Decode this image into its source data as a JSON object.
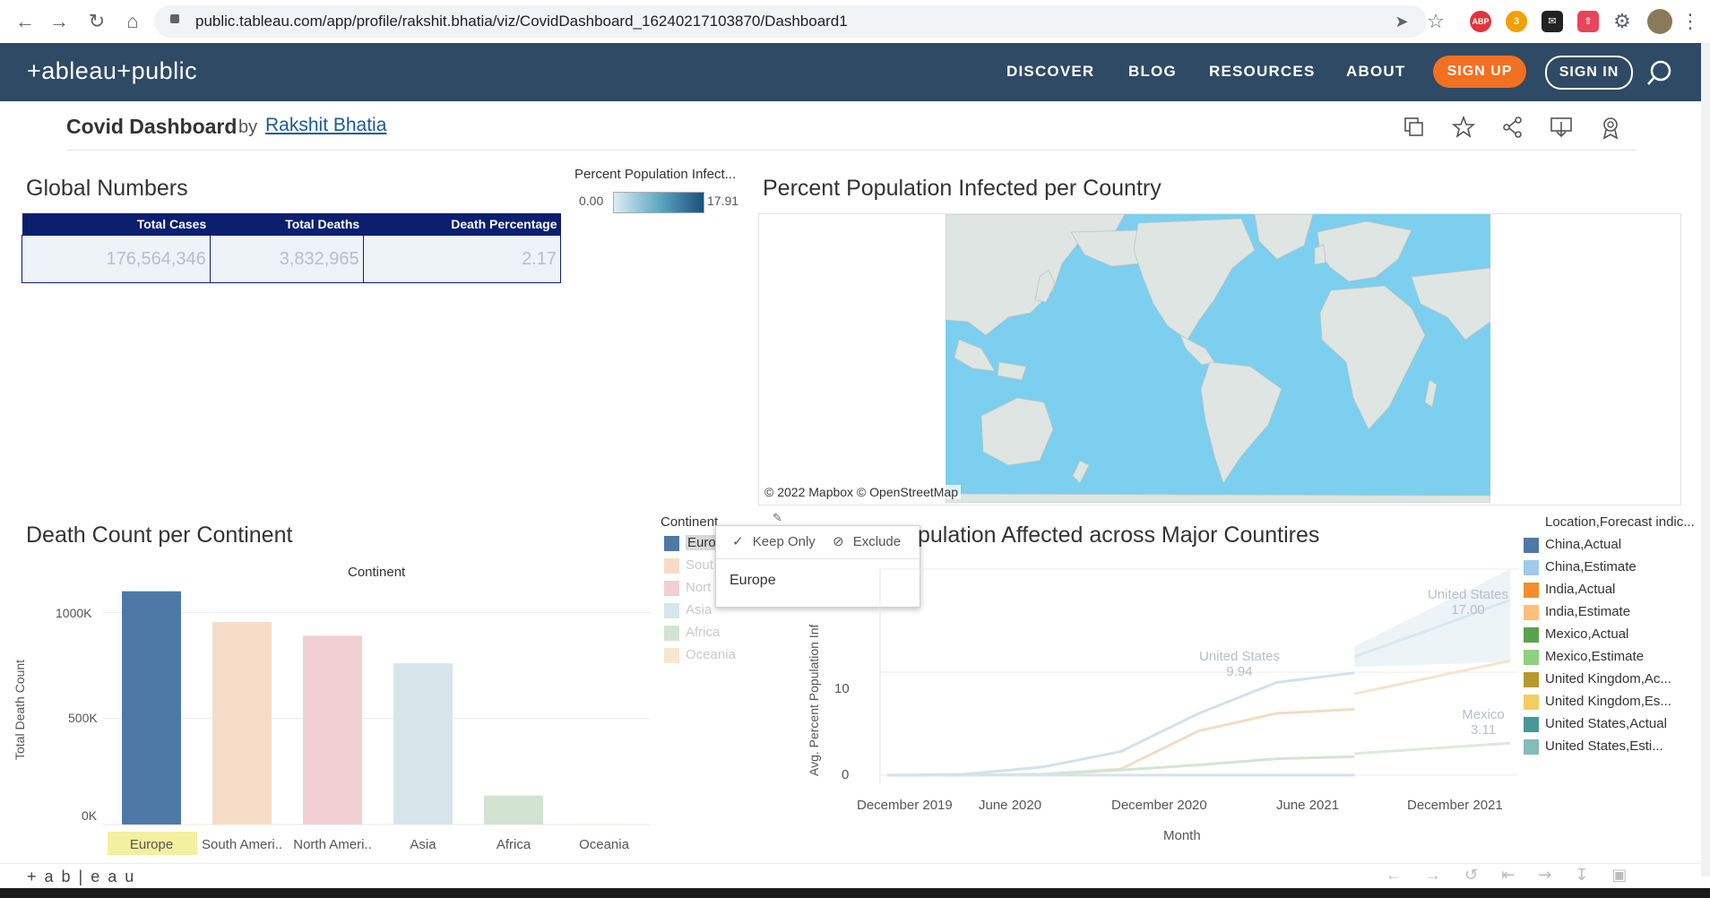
{
  "browser": {
    "url": "public.tableau.com/app/profile/rakshit.bhatia/viz/CovidDashboard_16240217103870/Dashboard1",
    "ext_badge": "3"
  },
  "header": {
    "logo": "+ableau+public",
    "nav": [
      "DISCOVER",
      "BLOG",
      "RESOURCES",
      "ABOUT"
    ],
    "signup": "SIGN UP",
    "signin": "SIGN IN"
  },
  "viz": {
    "title": "Covid Dashboard",
    "by": "by",
    "author": "Rakshit Bhatia"
  },
  "global_numbers": {
    "title": "Global Numbers",
    "headers": [
      "Total Cases",
      "Total Deaths",
      "Death Percentage"
    ],
    "values": [
      "176,564,346",
      "3,832,965",
      "2.17"
    ]
  },
  "map_legend": {
    "title": "Percent Population Infect...",
    "min": "0.00",
    "max": "17.91"
  },
  "map": {
    "title": "Percent Population Infected per Country",
    "attribution": "© 2022 Mapbox  © OpenStreetMap"
  },
  "continent_legend": {
    "title": "Continent",
    "items": [
      {
        "label": "Euro",
        "color": "#4e79a7"
      },
      {
        "label": "Sout",
        "color": "#f6dcc6"
      },
      {
        "label": "Nort",
        "color": "#f2cfd2"
      },
      {
        "label": "Asia",
        "color": "#d6e6ea"
      },
      {
        "label": "Africa",
        "color": "#d2e3d2"
      },
      {
        "label": "Oceania",
        "color": "#f5e8cf"
      }
    ]
  },
  "popup": {
    "keep_only": "Keep Only",
    "exclude": "Exclude",
    "selection": "Europe"
  },
  "bar_chart": {
    "title": "Death Count per Continent",
    "header": "Continent",
    "ylabel": "Total Death Count",
    "ticks": [
      "1000K",
      "500K",
      "0K"
    ]
  },
  "line_chart": {
    "title": "pulation Affected across Major Countires",
    "ylabel": "Avg. Percent Population Inf",
    "xlabel": "Month",
    "yticks": [
      "10",
      "0"
    ],
    "xticks": [
      "December 2019",
      "June 2020",
      "December 2020",
      "June 2021",
      "December 2021"
    ],
    "annotations": [
      {
        "country": "United States",
        "value": "9.94"
      },
      {
        "country": "United States",
        "value": "17.00"
      },
      {
        "country": "Mexico",
        "value": "3.11"
      }
    ]
  },
  "forecast_legend": {
    "title": "Location,Forecast indic...",
    "items": [
      {
        "label": "China,Actual",
        "color": "#4e79a7"
      },
      {
        "label": "China,Estimate",
        "color": "#a0cbe8"
      },
      {
        "label": "India,Actual",
        "color": "#f28e2b"
      },
      {
        "label": "India,Estimate",
        "color": "#ffbe7d"
      },
      {
        "label": "Mexico,Actual",
        "color": "#59a14f"
      },
      {
        "label": "Mexico,Estimate",
        "color": "#8cd17d"
      },
      {
        "label": "United Kingdom,Ac...",
        "color": "#b6992d"
      },
      {
        "label": "United Kingdom,Es...",
        "color": "#f1ce63"
      },
      {
        "label": "United States,Actual",
        "color": "#499894"
      },
      {
        "label": "United States,Esti...",
        "color": "#86bcb6"
      }
    ]
  },
  "footer": {
    "brand": "+ a b | e a u"
  },
  "chart_data": [
    {
      "type": "bar",
      "title": "Death Count per Continent",
      "xlabel": "Continent",
      "ylabel": "Total Death Count",
      "categories": [
        "Europe",
        "South Ameri..",
        "North Ameri..",
        "Asia",
        "Africa",
        "Oceania"
      ],
      "values": [
        1100000,
        955000,
        890000,
        760000,
        137000,
        1000
      ],
      "colors": [
        "#4e79a7",
        "#f6dcc6",
        "#f2cfd2",
        "#d6e6ea",
        "#d2e3d2",
        "#f5e8cf"
      ],
      "ylim": [
        0,
        1120000
      ],
      "highlighted": "Europe"
    },
    {
      "type": "line",
      "xlabel": "Month",
      "ylabel": "Avg. Percent Population Inf",
      "x": [
        "2019-12",
        "2020-03",
        "2020-06",
        "2020-09",
        "2020-12",
        "2021-03",
        "2021-06",
        "2021-09",
        "2021-12"
      ],
      "ylim": [
        0,
        20
      ],
      "series": [
        {
          "name": "United States,Actual",
          "values": [
            0,
            0.1,
            0.8,
            2.3,
            6.0,
            9.0,
            9.94,
            null,
            null
          ]
        },
        {
          "name": "United States,Estimate",
          "values": [
            null,
            null,
            null,
            null,
            null,
            null,
            11.5,
            14.2,
            17.0
          ]
        },
        {
          "name": "India,Actual",
          "values": [
            0,
            0,
            0.1,
            0.6,
            4.3,
            6.0,
            6.4,
            null,
            null
          ]
        },
        {
          "name": "India,Estimate",
          "values": [
            null,
            null,
            null,
            null,
            null,
            null,
            7.9,
            9.5,
            11.1
          ]
        },
        {
          "name": "Mexico,Actual",
          "values": [
            0,
            0,
            0.1,
            0.5,
            1.0,
            1.6,
            1.8,
            null,
            null
          ]
        },
        {
          "name": "Mexico,Estimate",
          "values": [
            null,
            null,
            null,
            null,
            null,
            null,
            2.1,
            2.6,
            3.11
          ]
        },
        {
          "name": "China,Actual",
          "values": [
            0,
            0.01,
            0.01,
            0.01,
            0.01,
            0.01,
            0.01,
            null,
            null
          ]
        }
      ]
    }
  ]
}
